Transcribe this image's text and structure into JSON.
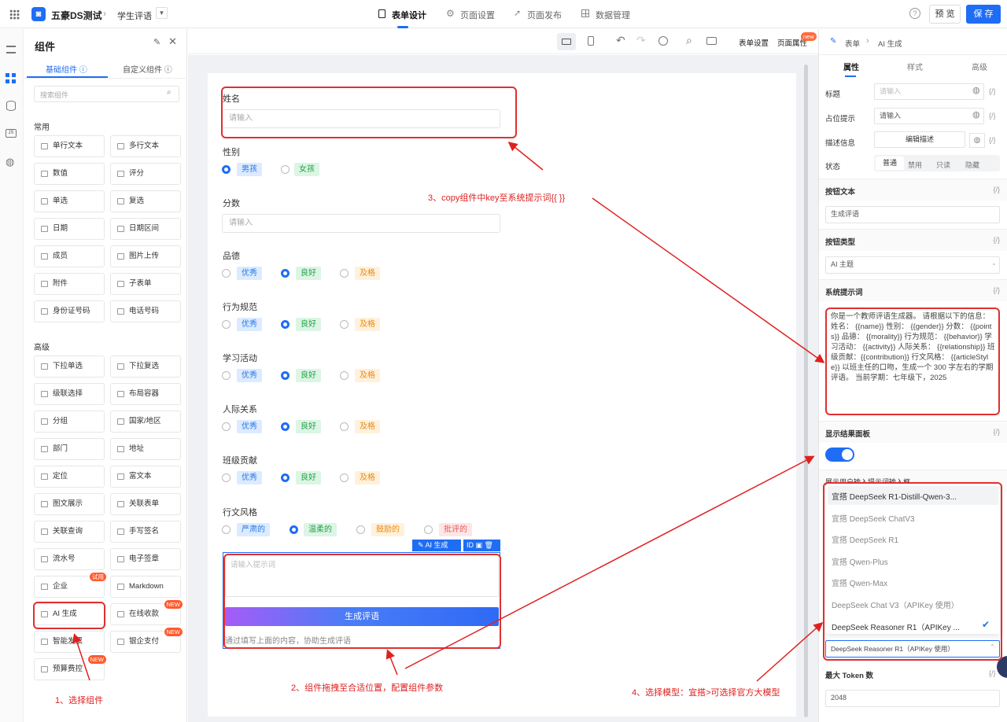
{
  "topbar": {
    "app_name": "五豪DS测试",
    "page_name": "学生评语",
    "tabs": [
      "表单设计",
      "页面设置",
      "页面发布",
      "数据管理"
    ],
    "preview": "预 览",
    "save": "保 存"
  },
  "left_panel": {
    "title": "组件",
    "tab_basic": "基础组件",
    "tab_custom": "自定义组件",
    "search_placeholder": "搜索组件",
    "section_common": "常用",
    "section_advanced": "高级",
    "common": [
      "单行文本",
      "多行文本",
      "数值",
      "评分",
      "单选",
      "复选",
      "日期",
      "日期区间",
      "成员",
      "图片上传",
      "附件",
      "子表单",
      "身份证号码",
      "电话号码"
    ],
    "advanced": [
      "下拉单选",
      "下拉复选",
      "级联选择",
      "布局容器",
      "分组",
      "国家/地区",
      "部门",
      "地址",
      "定位",
      "富文本",
      "图文展示",
      "关联表单",
      "关联查询",
      "手写签名",
      "流水号",
      "电子签章",
      "企业",
      "Markdown",
      "AI 生成",
      "在线收款",
      "智能发票",
      "银企支付",
      "预算费控"
    ],
    "badge_trial": "试用",
    "badge_new": "NEW"
  },
  "toolbar": {
    "form_settings": "表单设置",
    "page_props": "页面属性",
    "new_badge": "new"
  },
  "form": {
    "name_label": "姓名",
    "name_placeholder": "请输入",
    "gender_label": "性别",
    "gender_options": [
      "男孩",
      "女孩"
    ],
    "score_label": "分数",
    "score_placeholder": "请输入",
    "grade_rows": [
      {
        "label": "品德",
        "options": [
          "优秀",
          "良好",
          "及格"
        ]
      },
      {
        "label": "行为规范",
        "options": [
          "优秀",
          "良好",
          "及格"
        ]
      },
      {
        "label": "学习活动",
        "options": [
          "优秀",
          "良好",
          "及格"
        ]
      },
      {
        "label": "人际关系",
        "options": [
          "优秀",
          "良好",
          "及格"
        ]
      },
      {
        "label": "班级贡献",
        "options": [
          "优秀",
          "良好",
          "及格"
        ]
      }
    ],
    "style_label": "行文风格",
    "style_options": [
      "严肃的",
      "温柔的",
      "鼓励的",
      "批评的"
    ],
    "ai_chip": "AI 生成",
    "id_chip": "ID",
    "prompt_placeholder": "请输入提示词",
    "generate_btn": "生成评语",
    "hint": "通过填写上面的内容，协助生成评语"
  },
  "right_panel": {
    "breadcrumb_form": "表单",
    "breadcrumb_ai": "AI 生成",
    "tabs": [
      "属性",
      "样式",
      "高级"
    ],
    "title_label": "标题",
    "title_placeholder": "请输入",
    "placeholder_label": "占位提示",
    "placeholder_value": "请输入",
    "desc_label": "描述信息",
    "desc_btn": "编辑描述",
    "status_label": "状态",
    "status_options": [
      "普通",
      "禁用",
      "只读",
      "隐藏"
    ],
    "fx": "{/}",
    "btn_text_label": "按钮文本",
    "btn_text_value": "生成评语",
    "btn_type_label": "按钮类型",
    "btn_type_value": "AI 主题",
    "sys_prompt_label": "系统提示词",
    "sys_prompt_value": "你是一个教师评语生成器。 请根据以下的信息： 姓名： {{name}} 性别： {{gender}} 分数： {{points}} 品德： {{morality}} 行为规范： {{behavior}} 学习活动： {{activity}} 人际关系： {{relationship}} 班级贡献：{{contribution}} 行文风格： {{articleStyle}} 以班主任的口吻，生成一个 300 字左右的学期评语。 当前学期：七年级下，2025",
    "show_result_label": "显示结果面板",
    "show_input_label": "展示用户输入提示词输入框",
    "models": [
      "宜搭 DeepSeek R1-Distill-Qwen-3...",
      "宜搭 DeepSeek ChatV3",
      "宜搭 DeepSeek R1",
      "宜搭 Qwen-Plus",
      "宜搭 Qwen-Max",
      "DeepSeek Chat V3（APIKey 使用）",
      "DeepSeek Reasoner R1（APIKey ..."
    ],
    "model_selected": "DeepSeek Reasoner R1（APIKey 使用）",
    "max_token_label": "最大 Token 数",
    "max_token_value": "2048"
  },
  "annotations": {
    "a1": "1、选择组件",
    "a2": "2、组件拖拽至合适位置，配置组件参数",
    "a3": "3、copy组件中key至系统提示词{{ }}",
    "a4": "4、选择模型：宜搭>可选择官方大模型"
  },
  "colors": {
    "primary": "#1f6df5",
    "annotation": "#e02020"
  }
}
